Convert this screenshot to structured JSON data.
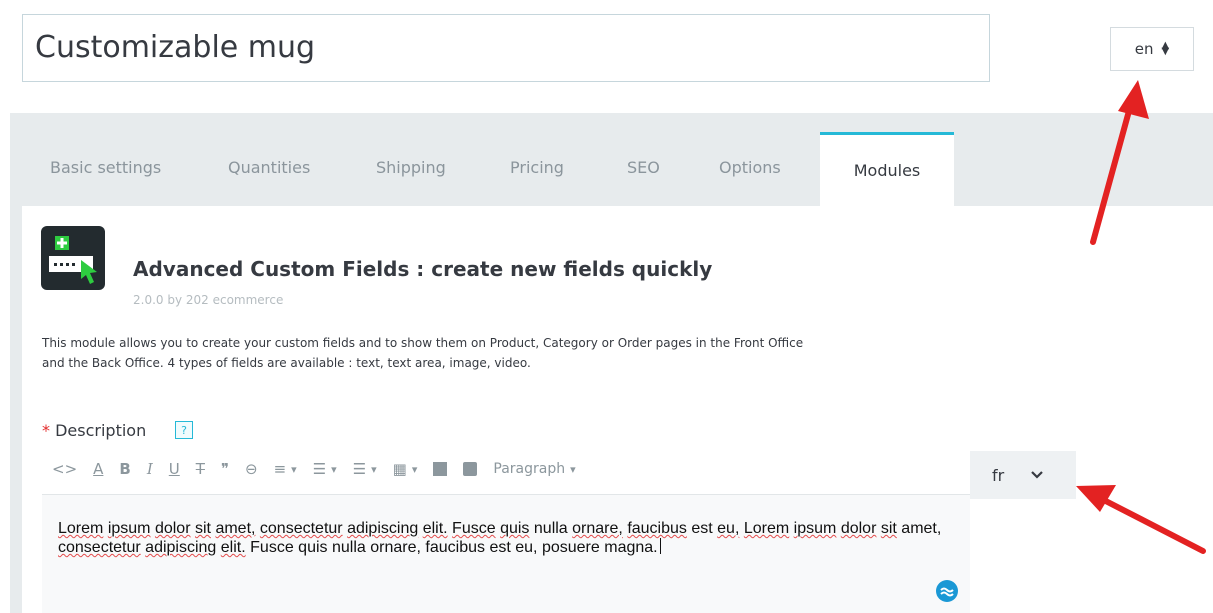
{
  "product": {
    "name": "Customizable mug"
  },
  "language_selector": {
    "value": "en"
  },
  "tabs": [
    {
      "label": "Basic settings"
    },
    {
      "label": "Quantities"
    },
    {
      "label": "Shipping"
    },
    {
      "label": "Pricing"
    },
    {
      "label": "SEO"
    },
    {
      "label": "Options"
    },
    {
      "label": "Modules",
      "active": true
    }
  ],
  "module": {
    "icon": "custom-fields-icon",
    "title": "Advanced Custom Fields : create new fields quickly",
    "version": "2.0.0 by 202 ecommerce",
    "description_line1": "This module allows you to create your custom fields and to show them on Product, Category or Order pages in the Front Office",
    "description_line2": "and the Back Office. 4 types of fields are available : text, text area, image, video."
  },
  "description_field": {
    "required_mark": "*",
    "label": "Description",
    "help": "?"
  },
  "toolbar": {
    "source": "<>",
    "text_color": "A",
    "bold": "B",
    "italic": "I",
    "underline": "U",
    "strike": "T",
    "quote": "❞",
    "link": "⊖",
    "align": "≡",
    "bullets": "☰",
    "numbered": "☰",
    "table": "▦",
    "format": "Paragraph"
  },
  "editor_language": {
    "value": "fr"
  },
  "editor": {
    "w1": "Lorem",
    "w2": "ipsum",
    "w3": "dolor",
    "w4": "sit",
    "w5": "amet,",
    "w6": "consectetur",
    "w7": "adipiscing",
    "w8": "elit.",
    "w9": "Fusce",
    "w10": "quis",
    "w11": "nulla",
    "w12": "ornare,",
    "w13": "faucibus",
    "w14": "est",
    "w15": "eu,",
    "w16": "Lorem",
    "w17": "ipsum",
    "w18": "dolor",
    "w19": "sit",
    "w20": "amet,",
    "w21": "consectetur",
    "w22": "adipiscing",
    "w23": "elit.",
    "w24": "Fusce",
    "w25": "quis",
    "w26": "nulla",
    "w27": "ornare,",
    "w28": "faucibus",
    "w29": "est",
    "w30": "eu,",
    "w31": "posuere",
    "w32": "magna."
  },
  "colors": {
    "accent": "#25b9d7",
    "required": "#e32b2b",
    "annotation_arrow": "#e32222",
    "spellcheck_underline": "#e34b4b"
  }
}
